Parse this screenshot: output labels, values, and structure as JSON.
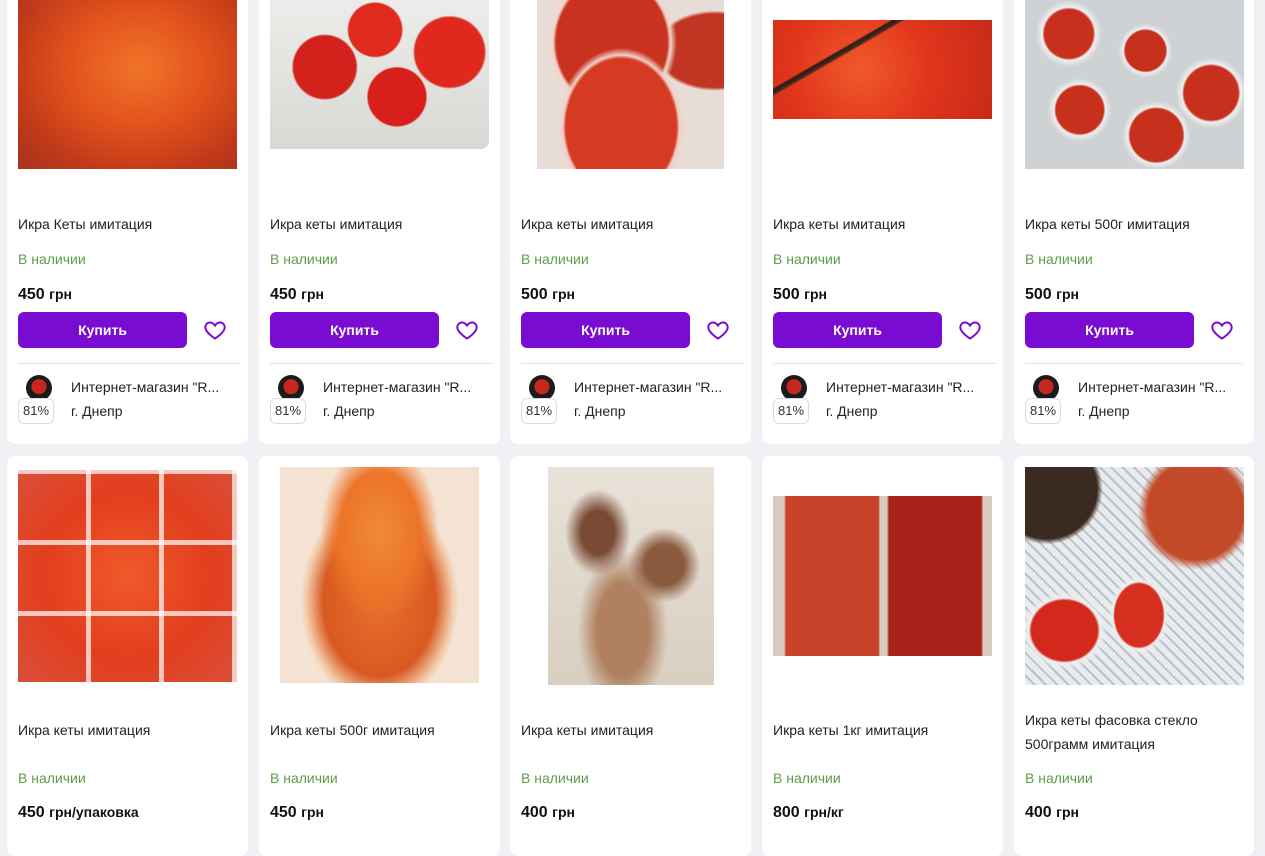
{
  "buy_label": "Купить",
  "colors": {
    "accent": "#7a0bd1",
    "in_stock": "#5a9e46"
  },
  "row1": [
    {
      "title": "Икра Кеты имитация",
      "stock": "В наличии",
      "price": "450",
      "unit": "грн",
      "seller": "Интернет-магазин \"R...",
      "city": "г. Днепр",
      "rating": "81%"
    },
    {
      "title": "Икра кеты имитация",
      "stock": "В наличии",
      "price": "450",
      "unit": "грн",
      "seller": "Интернет-магазин \"R...",
      "city": "г. Днепр",
      "rating": "81%"
    },
    {
      "title": "Икра кеты имитация",
      "stock": "В наличии",
      "price": "500",
      "unit": "грн",
      "seller": "Интернет-магазин \"R...",
      "city": "г. Днепр",
      "rating": "81%"
    },
    {
      "title": "Икра кеты имитация",
      "stock": "В наличии",
      "price": "500",
      "unit": "грн",
      "seller": "Интернет-магазин \"R...",
      "city": "г. Днепр",
      "rating": "81%"
    },
    {
      "title": "Икра кеты 500г имитация",
      "stock": "В наличии",
      "price": "500",
      "unit": "грн",
      "seller": "Интернет-магазин \"R...",
      "city": "г. Днепр",
      "rating": "81%"
    }
  ],
  "row2": [
    {
      "title": "Икра кеты имитация",
      "stock": "В наличии",
      "price": "450",
      "unit": "грн/упаковка"
    },
    {
      "title": "Икра кеты 500г имитация",
      "stock": "В наличии",
      "price": "450",
      "unit": "грн"
    },
    {
      "title": "Икра кеты имитация",
      "stock": "В наличии",
      "price": "400",
      "unit": "грн"
    },
    {
      "title": "Икра кеты 1кг имитация",
      "stock": "В наличии",
      "price": "800",
      "unit": "грн/кг"
    },
    {
      "title": "Икра кеты фасовка стекло 500грамм имитация",
      "stock": "В наличии",
      "price": "400",
      "unit": "грн"
    }
  ]
}
